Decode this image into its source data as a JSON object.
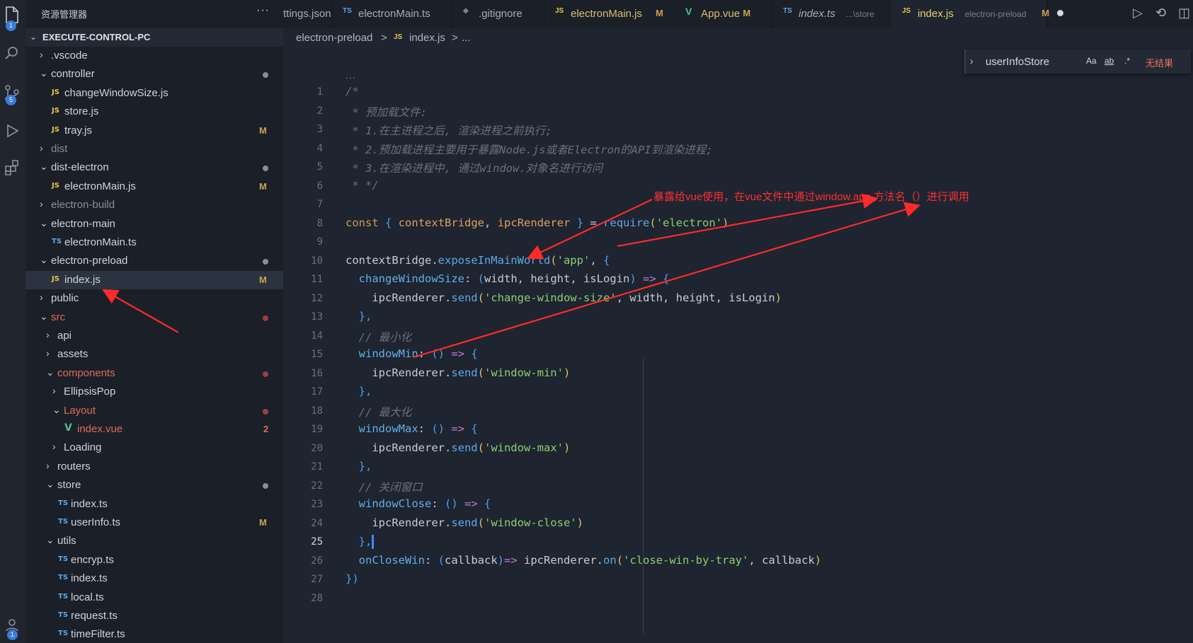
{
  "activity_bar": {
    "badges": {
      "explorer": "1",
      "source_control": "5",
      "account": "1"
    }
  },
  "sidebar": {
    "header": "资源管理器",
    "more": "···",
    "section_title": "EXECUTE-CONTROL-PC",
    "items": [
      {
        "label": ".vscode",
        "kind": "folder",
        "state": "closed",
        "depth": 0,
        "decoration": ""
      },
      {
        "label": "controller",
        "kind": "folder",
        "state": "open",
        "depth": 0,
        "decoration": "dot"
      },
      {
        "label": "changeWindowSize.js",
        "kind": "js",
        "depth": 1,
        "decoration": ""
      },
      {
        "label": "store.js",
        "kind": "js",
        "depth": 1,
        "decoration": ""
      },
      {
        "label": "tray.js",
        "kind": "js",
        "depth": 1,
        "decoration": "M"
      },
      {
        "label": "dist",
        "kind": "folder",
        "state": "closed",
        "depth": 0,
        "decoration": "",
        "dim": true
      },
      {
        "label": "dist-electron",
        "kind": "folder",
        "state": "open",
        "depth": 0,
        "decoration": "dot"
      },
      {
        "label": "electronMain.js",
        "kind": "js",
        "depth": 1,
        "decoration": "M"
      },
      {
        "label": "electron-build",
        "kind": "folder",
        "state": "closed",
        "depth": 0,
        "decoration": "",
        "dim": true
      },
      {
        "label": "electron-main",
        "kind": "folder",
        "state": "open",
        "depth": 0,
        "decoration": ""
      },
      {
        "label": "electronMain.ts",
        "kind": "ts",
        "depth": 1,
        "decoration": ""
      },
      {
        "label": "electron-preload",
        "kind": "folder",
        "state": "open",
        "depth": 0,
        "decoration": "dot"
      },
      {
        "label": "index.js",
        "kind": "js",
        "depth": 1,
        "decoration": "M",
        "selected": true
      },
      {
        "label": "public",
        "kind": "folder",
        "state": "closed",
        "depth": 0,
        "decoration": ""
      },
      {
        "label": "src",
        "kind": "folder",
        "state": "open",
        "depth": 0,
        "decoration": "dotred",
        "red": true
      },
      {
        "label": "api",
        "kind": "folder",
        "state": "closed",
        "depth": 1,
        "decoration": ""
      },
      {
        "label": "assets",
        "kind": "folder",
        "state": "closed",
        "depth": 1,
        "decoration": ""
      },
      {
        "label": "components",
        "kind": "folder",
        "state": "open",
        "depth": 1,
        "decoration": "dotred",
        "red": true
      },
      {
        "label": "EllipsisPop",
        "kind": "folder",
        "state": "closed",
        "depth": 2,
        "decoration": ""
      },
      {
        "label": "Layout",
        "kind": "folder",
        "state": "open",
        "depth": 2,
        "decoration": "dotred",
        "red": true
      },
      {
        "label": "index.vue",
        "kind": "vue",
        "depth": 3,
        "decoration": "2",
        "red": true
      },
      {
        "label": "Loading",
        "kind": "folder",
        "state": "closed",
        "depth": 2,
        "decoration": ""
      },
      {
        "label": "routers",
        "kind": "folder",
        "state": "closed",
        "depth": 1,
        "decoration": ""
      },
      {
        "label": "store",
        "kind": "folder",
        "state": "open",
        "depth": 1,
        "decoration": "dot"
      },
      {
        "label": "index.ts",
        "kind": "ts",
        "depth": 2,
        "decoration": ""
      },
      {
        "label": "userInfo.ts",
        "kind": "ts",
        "depth": 2,
        "decoration": "M"
      },
      {
        "label": "utils",
        "kind": "folder",
        "state": "open",
        "depth": 1,
        "decoration": ""
      },
      {
        "label": "encryp.ts",
        "kind": "ts",
        "depth": 2,
        "decoration": ""
      },
      {
        "label": "index.ts",
        "kind": "ts",
        "depth": 2,
        "decoration": ""
      },
      {
        "label": "local.ts",
        "kind": "ts",
        "depth": 2,
        "decoration": ""
      },
      {
        "label": "request.ts",
        "kind": "ts",
        "depth": 2,
        "decoration": ""
      },
      {
        "label": "timeFilter.ts",
        "kind": "ts",
        "depth": 2,
        "decoration": ""
      }
    ]
  },
  "tabs": [
    {
      "label": "ttings.json",
      "kind": "json",
      "detail": "",
      "mark": ""
    },
    {
      "label": "electronMain.ts",
      "kind": "ts",
      "detail": "",
      "mark": ""
    },
    {
      "label": ".gitignore",
      "kind": "git",
      "detail": "",
      "mark": ""
    },
    {
      "label": "electronMain.js",
      "kind": "js",
      "detail": "",
      "mark": "M"
    },
    {
      "label": "App.vue",
      "kind": "vue",
      "detail": "",
      "mark": "M"
    },
    {
      "label": "index.ts",
      "kind": "ts",
      "detail": "...\\store",
      "mark": ""
    },
    {
      "label": "index.js",
      "kind": "js",
      "detail": "electron-preload",
      "mark": "M",
      "active": true
    }
  ],
  "breadcrumb": {
    "folder": "electron-preload",
    "sep": ">",
    "file": "index.js",
    "more": "..."
  },
  "find": {
    "query": "userInfoStore",
    "opt_case": "Aa",
    "opt_word": "ab",
    "opt_regex": ".*",
    "result": "无结果"
  },
  "editor": {
    "fold_ellipsis": "...",
    "current_line": 25,
    "lines": [
      [
        [
          "c-comment",
          "/*"
        ]
      ],
      [
        [
          "c-comment",
          " * 预加载文件:"
        ]
      ],
      [
        [
          "c-comment",
          " * 1.在主进程之后, 渲染进程之前执行;"
        ]
      ],
      [
        [
          "c-comment",
          " * 2.预加载进程主要用于暴露Node.js或者Electron的API到渲染进程;"
        ]
      ],
      [
        [
          "c-comment",
          " * 3.在渲染进程中, 通过window.对象名进行访问"
        ]
      ],
      [
        [
          "c-comment",
          " * */"
        ]
      ],
      [],
      [
        [
          "c-kw",
          "const"
        ],
        [
          "c-plain",
          " "
        ],
        [
          "c-brace",
          "{"
        ],
        [
          "c-plain",
          " "
        ],
        [
          "c-var",
          "contextBridge"
        ],
        [
          "c-plain",
          ", "
        ],
        [
          "c-var",
          "ipcRenderer"
        ],
        [
          "c-plain",
          " "
        ],
        [
          "c-brace",
          "}"
        ],
        [
          "c-plain",
          " = "
        ],
        [
          "c-fn",
          "require"
        ],
        [
          "c-paren",
          "("
        ],
        [
          "c-str",
          "'electron'"
        ],
        [
          "c-paren",
          ")"
        ]
      ],
      [],
      [
        [
          "c-plain",
          "contextBridge."
        ],
        [
          "c-fn",
          "exposeInMainWorld"
        ],
        [
          "c-paren",
          "("
        ],
        [
          "c-str",
          "'app'"
        ],
        [
          "c-plain",
          ", "
        ],
        [
          "c-brace",
          "{"
        ]
      ],
      [
        [
          "c-plain",
          "  "
        ],
        [
          "c-prop",
          "changeWindowSize"
        ],
        [
          "c-plain",
          ": "
        ],
        [
          "c-brace",
          "("
        ],
        [
          "c-plain",
          "width, height, isLogin"
        ],
        [
          "c-brace",
          ")"
        ],
        [
          "c-plain",
          " "
        ],
        [
          "c-arrow",
          "=>"
        ],
        [
          "c-plain",
          " "
        ],
        [
          "c-brace",
          "{"
        ]
      ],
      [
        [
          "c-plain",
          "    ipcRenderer."
        ],
        [
          "c-fn",
          "send"
        ],
        [
          "c-paren",
          "("
        ],
        [
          "c-str",
          "'change-window-size'"
        ],
        [
          "c-plain",
          ", width, height, isLogin"
        ],
        [
          "c-paren",
          ")"
        ]
      ],
      [
        [
          "c-plain",
          "  "
        ],
        [
          "c-brace",
          "},"
        ]
      ],
      [
        [
          "c-plain",
          "  "
        ],
        [
          "c-comment",
          "// 最小化"
        ]
      ],
      [
        [
          "c-plain",
          "  "
        ],
        [
          "c-prop",
          "windowMin"
        ],
        [
          "c-plain",
          ": "
        ],
        [
          "c-brace",
          "()"
        ],
        [
          "c-plain",
          " "
        ],
        [
          "c-arrow",
          "=>"
        ],
        [
          "c-plain",
          " "
        ],
        [
          "c-brace",
          "{"
        ]
      ],
      [
        [
          "c-plain",
          "    ipcRenderer."
        ],
        [
          "c-fn",
          "send"
        ],
        [
          "c-paren",
          "("
        ],
        [
          "c-str",
          "'window-min'"
        ],
        [
          "c-paren",
          ")"
        ]
      ],
      [
        [
          "c-plain",
          "  "
        ],
        [
          "c-brace",
          "},"
        ]
      ],
      [
        [
          "c-plain",
          "  "
        ],
        [
          "c-comment",
          "// 最大化"
        ]
      ],
      [
        [
          "c-plain",
          "  "
        ],
        [
          "c-prop",
          "windowMax"
        ],
        [
          "c-plain",
          ": "
        ],
        [
          "c-brace",
          "()"
        ],
        [
          "c-plain",
          " "
        ],
        [
          "c-arrow",
          "=>"
        ],
        [
          "c-plain",
          " "
        ],
        [
          "c-brace",
          "{"
        ]
      ],
      [
        [
          "c-plain",
          "    ipcRenderer."
        ],
        [
          "c-fn",
          "send"
        ],
        [
          "c-paren",
          "("
        ],
        [
          "c-str",
          "'window-max'"
        ],
        [
          "c-paren",
          ")"
        ]
      ],
      [
        [
          "c-plain",
          "  "
        ],
        [
          "c-brace",
          "},"
        ]
      ],
      [
        [
          "c-plain",
          "  "
        ],
        [
          "c-comment",
          "// 关闭窗口"
        ]
      ],
      [
        [
          "c-plain",
          "  "
        ],
        [
          "c-prop",
          "windowClose"
        ],
        [
          "c-plain",
          ": "
        ],
        [
          "c-brace",
          "()"
        ],
        [
          "c-plain",
          " "
        ],
        [
          "c-arrow",
          "=>"
        ],
        [
          "c-plain",
          " "
        ],
        [
          "c-brace",
          "{"
        ]
      ],
      [
        [
          "c-plain",
          "    ipcRenderer."
        ],
        [
          "c-fn",
          "send"
        ],
        [
          "c-paren",
          "("
        ],
        [
          "c-str",
          "'window-close'"
        ],
        [
          "c-paren",
          ")"
        ]
      ],
      [
        [
          "c-plain",
          "  "
        ],
        [
          "c-brace",
          "},"
        ]
      ],
      [
        [
          "c-plain",
          "  "
        ],
        [
          "c-prop",
          "onCloseWin"
        ],
        [
          "c-plain",
          ": "
        ],
        [
          "c-brace",
          "("
        ],
        [
          "c-plain",
          "callback"
        ],
        [
          "c-brace",
          ")"
        ],
        [
          "c-arrow",
          "=>"
        ],
        [
          "c-plain",
          " ipcRenderer."
        ],
        [
          "c-fn",
          "on"
        ],
        [
          "c-paren",
          "("
        ],
        [
          "c-str",
          "'close-win-by-tray'"
        ],
        [
          "c-plain",
          ", callback"
        ],
        [
          "c-paren",
          ")"
        ]
      ],
      [
        [
          "c-brace",
          "})"
        ]
      ],
      []
    ]
  },
  "annotation": {
    "text": "暴露给vue使用，在vue文件中通过window.app.方法名（）进行调用",
    "color": "#ff3030"
  },
  "colors": {
    "js": "#e8c84a",
    "ts": "#5fa8e8",
    "vue": "#4fc08d",
    "modified": "#c9a34f",
    "error": "#e06c5c",
    "accent": "#3b7be0"
  }
}
